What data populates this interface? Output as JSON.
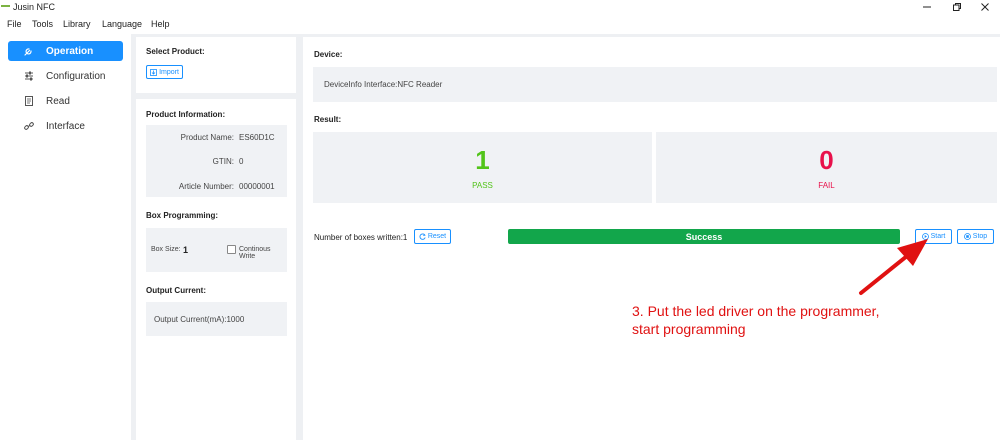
{
  "window": {
    "title": "Jusin NFC"
  },
  "menu": [
    "File",
    "Tools",
    "Library",
    "Language",
    "Help"
  ],
  "sidebar": {
    "items": [
      {
        "label": "Operation",
        "icon": "wrench-icon",
        "active": true
      },
      {
        "label": "Configuration",
        "icon": "sliders-icon",
        "active": false
      },
      {
        "label": "Read",
        "icon": "document-icon",
        "active": false
      },
      {
        "label": "Interface",
        "icon": "link-icon",
        "active": false
      }
    ]
  },
  "select_product": {
    "title": "Select Product:",
    "import_label": "Import"
  },
  "product_info": {
    "title": "Product Information:",
    "name_label": "Product Name:",
    "name_value": "ES60D1C",
    "gtin_label": "GTIN:",
    "gtin_value": "0",
    "article_label": "Article Number:",
    "article_value": "00000001"
  },
  "box_programming": {
    "title": "Box Programming:",
    "size_label": "Box Size:",
    "size_value": "1",
    "continuous_label": "Continous Write"
  },
  "output_current": {
    "title": "Output Current:",
    "text": "Output Current(mA):1000"
  },
  "device": {
    "title": "Device:",
    "info": "DeviceInfo Interface:NFC Reader"
  },
  "result": {
    "title": "Result:",
    "pass_count": "1",
    "pass_label": "PASS",
    "fail_count": "0",
    "fail_label": "FAIL"
  },
  "controls": {
    "boxes_written": "Number of boxes written:1",
    "reset_label": "Reset",
    "status": "Success",
    "start_label": "Start",
    "stop_label": "Stop"
  },
  "annotation": {
    "line1": "3. Put the led driver on the programmer,",
    "line2": "start programming"
  },
  "colors": {
    "accent": "#1890ff",
    "pass": "#52c41a",
    "fail": "#e8114b",
    "success_bar": "#12a64b",
    "annotation": "#e01111"
  }
}
